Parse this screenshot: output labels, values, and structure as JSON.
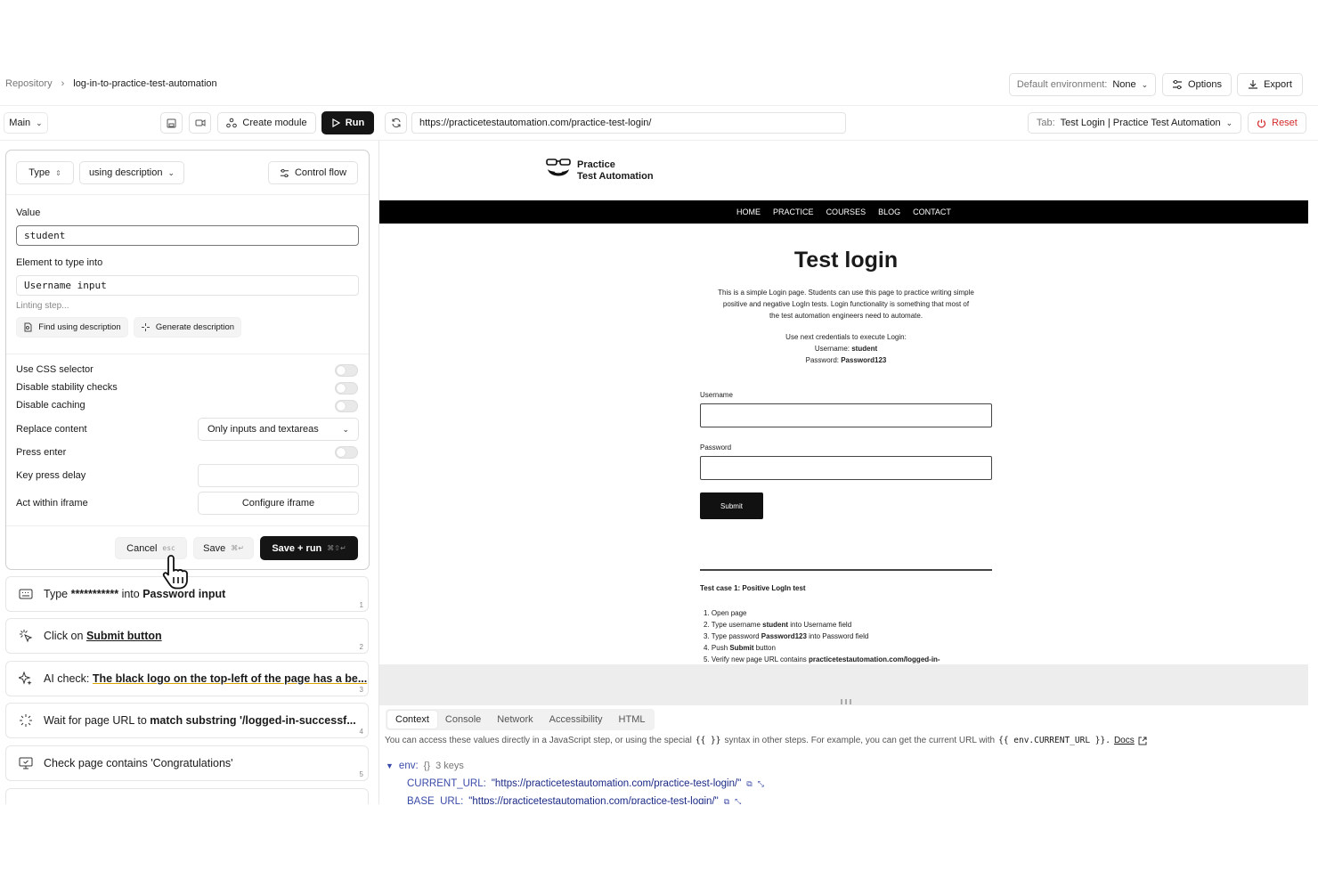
{
  "breadcrumb": {
    "root": "Repository",
    "separator": "›",
    "current": "log-in-to-practice-test-automation"
  },
  "header": {
    "env_label": "Default environment:",
    "env_value": "None",
    "options_label": "Options",
    "export_label": "Export"
  },
  "toolbar": {
    "branch": "Main",
    "create_module_label": "Create module",
    "run_label": "Run",
    "url": "https://practicetestautomation.com/practice-test-login/",
    "tab_prefix": "Tab:",
    "tab_value": "Test Login | Practice Test Automation",
    "reset_label": "Reset"
  },
  "editor": {
    "action_type": "Type",
    "locator_mode": "using description",
    "control_flow_label": "Control flow",
    "value_label": "Value",
    "value": "student",
    "element_label": "Element to type into",
    "element_value": "Username input",
    "linting": "Linting step...",
    "find_button": "Find using description",
    "generate_button": "Generate description",
    "options": {
      "css_selector": "Use CSS selector",
      "stability": "Disable stability checks",
      "caching": "Disable caching",
      "replace": "Replace content",
      "replace_value": "Only inputs and textareas",
      "press_enter": "Press enter",
      "key_delay": "Key press delay",
      "iframe": "Act within iframe",
      "iframe_button": "Configure iframe"
    },
    "cancel_label": "Cancel",
    "cancel_hint": "esc",
    "save_label": "Save",
    "save_hint": "⌘↵",
    "save_run_label": "Save + run",
    "save_run_hint": "⌘⇧↵"
  },
  "steps": [
    {
      "pre": "Type ",
      "mid": "*********** ",
      "mid2": "into ",
      "bold": "Password input",
      "num": "1"
    },
    {
      "pre": "Click on ",
      "bold": "Submit button",
      "num": "2"
    },
    {
      "pre": "AI check: ",
      "link": "The black logo on the top-left of the page has a be...",
      "num": "3"
    },
    {
      "pre": "Wait for page URL to ",
      "bold": "match substring '/logged-in-successf...",
      "num": "4"
    },
    {
      "pre": "Check page contains 'Congratulations'",
      "num": "5"
    }
  ],
  "site": {
    "logo_line1": "Practice",
    "logo_line2": "Test Automation",
    "nav": [
      "HOME",
      "PRACTICE",
      "COURSES",
      "BLOG",
      "CONTACT"
    ],
    "heading": "Test login",
    "intro_1": "This is a simple Login page. Students can use this page to practice writing simple",
    "intro_2": "positive and negative LogIn tests. Login functionality is something that most of",
    "intro_3": "the test automation engineers need to automate.",
    "creds_intro": "Use next credentials to execute Login:",
    "username_prefix": "Username: ",
    "username": "student",
    "password_prefix": "Password: ",
    "password": "Password123",
    "username_label": "Username",
    "password_label": "Password",
    "submit": "Submit",
    "testcase_title": "Test case 1: Positive LogIn test",
    "testcase_steps": [
      {
        "n": "1. ",
        "pre": "Open page",
        "bold": "",
        "post": ""
      },
      {
        "n": "2. ",
        "pre": "Type username ",
        "bold": "student",
        "post": " into Username field"
      },
      {
        "n": "3. ",
        "pre": "Type password ",
        "bold": "Password123",
        "post": " into Password field"
      },
      {
        "n": "4. ",
        "pre": "Push ",
        "bold": "Submit",
        "post": " button"
      },
      {
        "n": "5. ",
        "pre": "Verify new page URL contains ",
        "bold": "practicetestautomation.com/logged-in-",
        "post": ""
      }
    ]
  },
  "devtools": {
    "tabs": [
      "Context",
      "Console",
      "Network",
      "Accessibility",
      "HTML"
    ],
    "note_pre": "You can access these values directly in a JavaScript step, or using the special",
    "note_code1": "{{ }}",
    "note_mid": "syntax in other steps. For example, you can get the current URL with",
    "note_code2": "{{ env.CURRENT_URL }}.",
    "docs_label": "Docs",
    "env_label": "env:",
    "env_meta": "{}  3 keys",
    "current_url_key": "CURRENT_URL:",
    "current_url_val": "\"https://practicetestautomation.com/practice-test-login/\"",
    "base_url_key": "BASE_URL:",
    "base_url_val": "\"https://practicetestautomation.com/practice-test-login/\""
  }
}
